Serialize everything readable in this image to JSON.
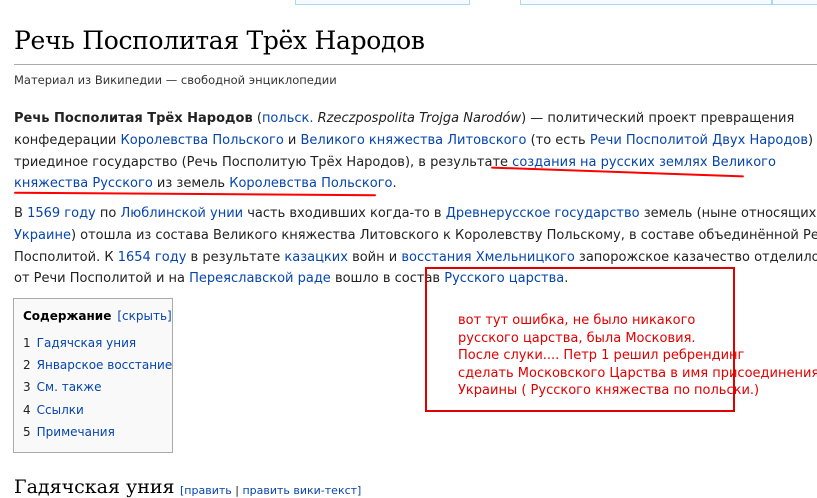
{
  "page": {
    "title": "Речь Посполитая Трёх Народов",
    "tagline": "Материал из Википедии — свободной энциклопедии"
  },
  "para1": {
    "l1": {
      "bold": "Речь Посполитая Трёх Народов",
      "t1": " (",
      "lang": "польск.",
      "t2": " ",
      "italic": "Rzeczpospolita Trojga Narodów",
      "t3": ") — политический проект превращения"
    },
    "l2": {
      "t1": "конфедерации ",
      "link1": "Королевства Польского",
      "t2": " и ",
      "link2": "Великого княжества Литовского",
      "t3": " (то есть ",
      "link3": "Речи Посполитой Двух Народов",
      "t4": ") в"
    },
    "l3": {
      "t1": "триединое государство (Речь Посполитую Трёх Народов), в результате ",
      "link1": "создания на русских землях",
      "t2": " ",
      "link2": "Великого"
    },
    "l4": {
      "link1": "княжества Русского",
      "t1": " из земель ",
      "link2": "Королевства Польского",
      "t2": "."
    }
  },
  "para2": {
    "l1": {
      "t1": "В ",
      "link1": "1569 году",
      "t2": " по ",
      "link2": "Люблинской унии",
      "t3": " часть входивших когда-то в ",
      "link3": "Древнерусское государство",
      "t4": " земель (ныне относящихся к"
    },
    "l2": {
      "link1": "Украине",
      "t1": ") отошла из состава Великого княжества Литовского к Королевству Польскому, в составе объединённой Речи"
    },
    "l3": {
      "t1": "Посполитой. К ",
      "link1": "1654 году",
      "t2": " в результате ",
      "link2": "казацких",
      "t3": " войн и ",
      "link3": "восстания Хмельницкого",
      "t4": " запорожское казачество отделилось"
    },
    "l4": {
      "t1": "от Речи Посполитой и на ",
      "link1": "Переяславской раде",
      "t2": " вошло в состав ",
      "link2": "Русского царства",
      "t3": "."
    }
  },
  "toc": {
    "title": "Содержание",
    "hide_label": "[скрыть]",
    "items": [
      {
        "num": "1",
        "label": "Гадячская уния"
      },
      {
        "num": "2",
        "label": "Январское восстание"
      },
      {
        "num": "3",
        "label": "См. также"
      },
      {
        "num": "4",
        "label": "Ссылки"
      },
      {
        "num": "5",
        "label": "Примечания"
      }
    ]
  },
  "section": {
    "heading": "Гадячская уния",
    "edit_label": "[править",
    "edit_wiki_label": "править вики-текст]"
  },
  "annotation": {
    "lines": [
      "вот тут ошибка, не было никакого",
      "русского царства, была Московия.",
      "После слуки.... Петр 1 решил ребрендинг",
      "сделать Московского Царства в имя присоединения",
      "Украины ( Русского княжества по польски.)"
    ],
    "color": "#e00000"
  },
  "colors": {
    "link": "#0645ad",
    "annotation_red": "#ff0000"
  }
}
